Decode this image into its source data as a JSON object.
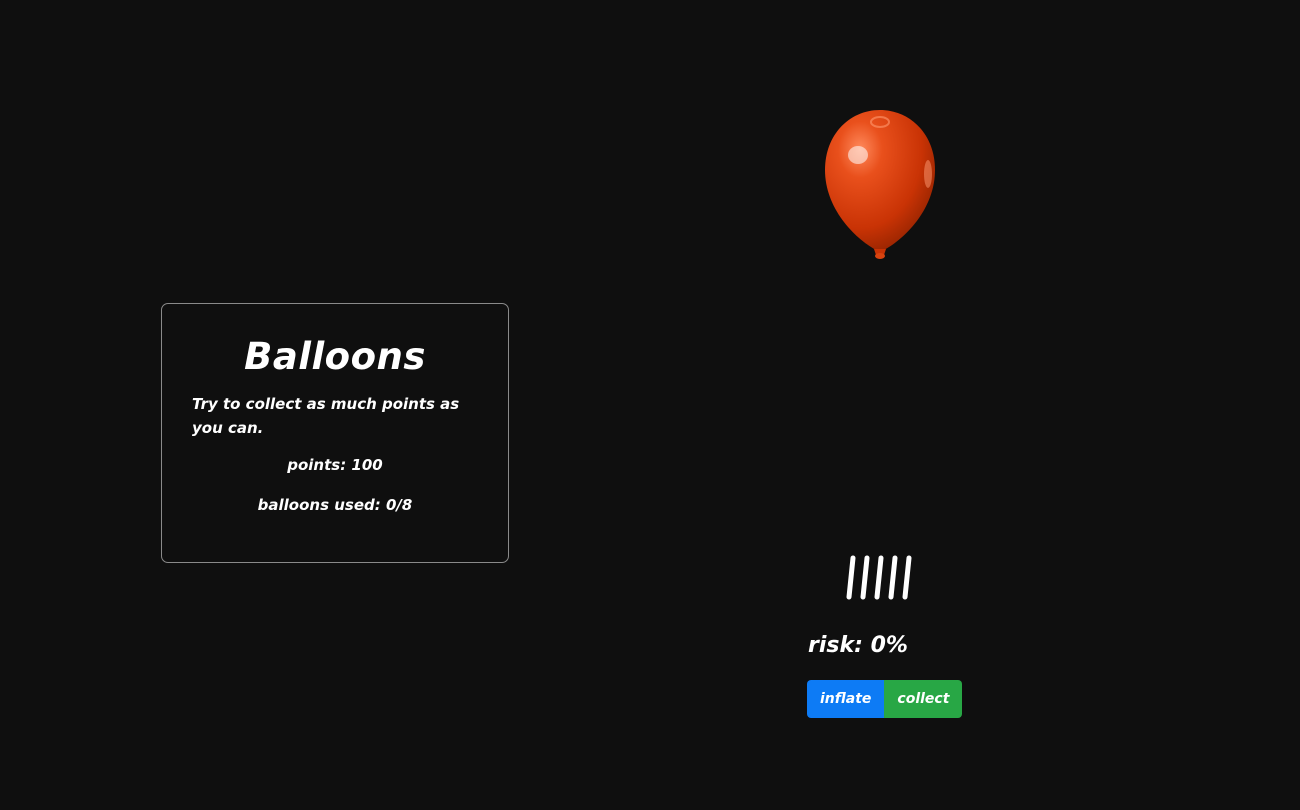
{
  "info": {
    "title": "Balloons",
    "description": "Try to collect as much points as you can.",
    "points_label": "points: 100",
    "balloons_used_label": "balloons used: 0/8"
  },
  "game": {
    "balloon_color": "#d2390a",
    "tally_count": 5,
    "risk_label": "risk: 0%"
  },
  "controls": {
    "inflate_label": "inflate",
    "collect_label": "collect",
    "inflate_color": "#0d7bf5",
    "collect_color": "#28a745"
  }
}
